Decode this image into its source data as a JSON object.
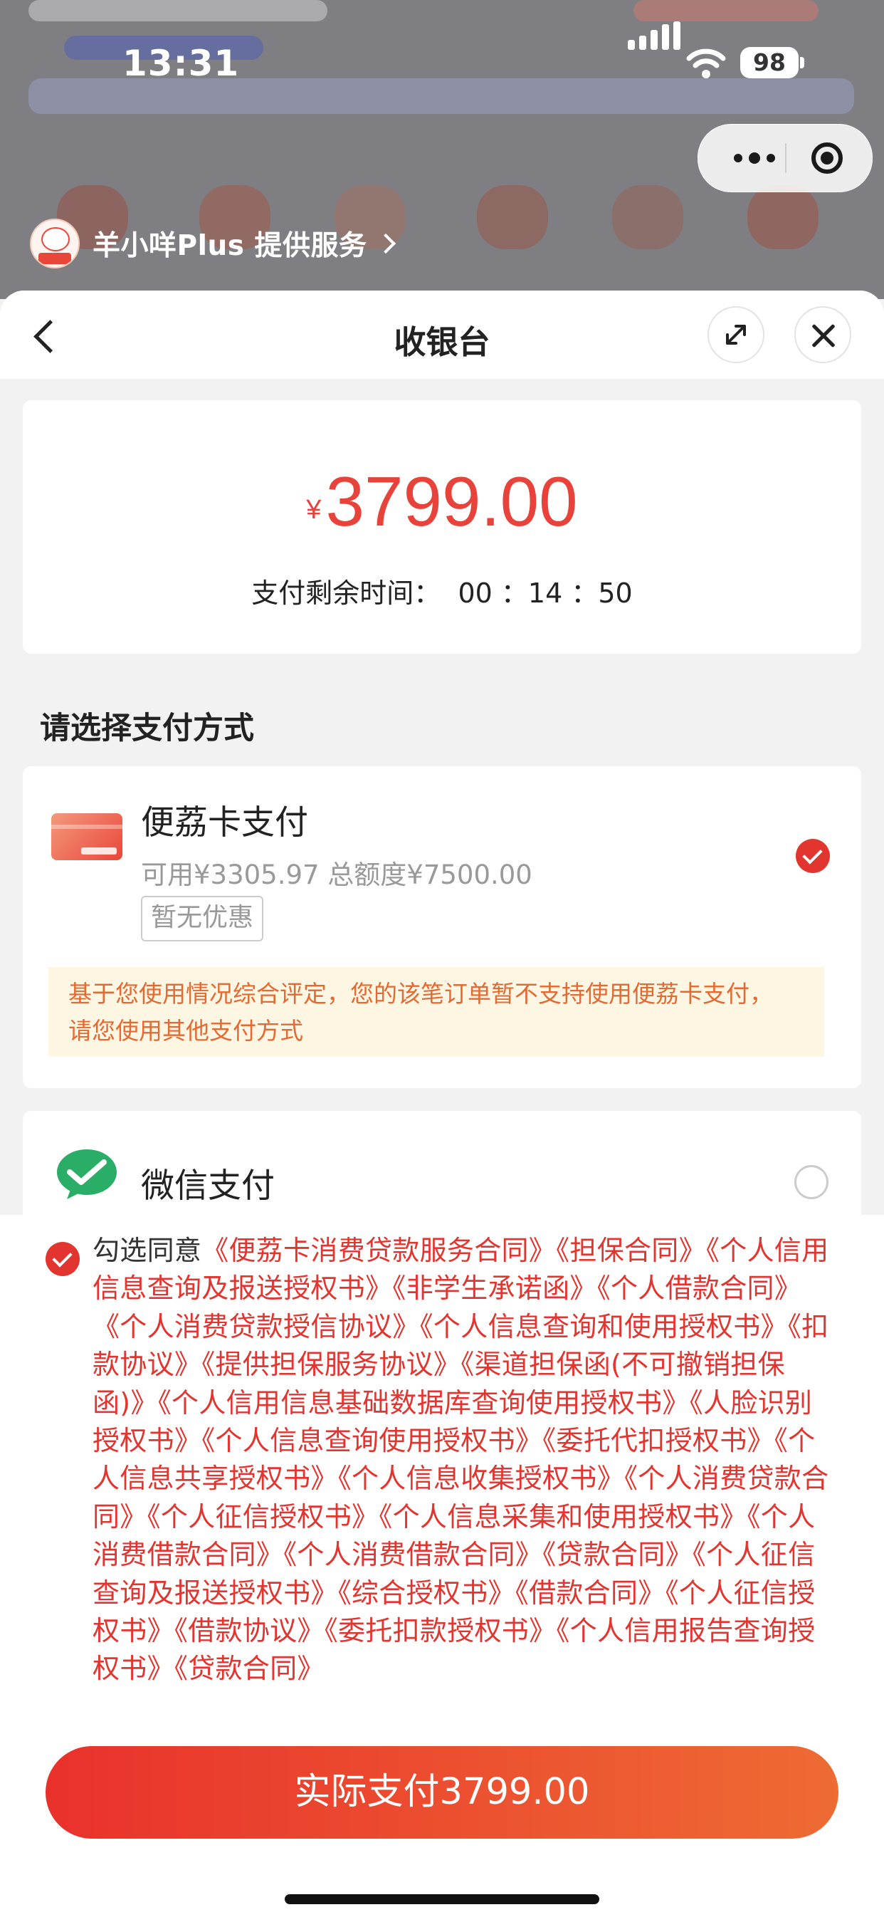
{
  "status_bar": {
    "time": "13:31",
    "battery": "98"
  },
  "mini_program": {
    "provider_text": "羊小咩Plus 提供服务"
  },
  "sheet": {
    "title": "收银台",
    "amount": {
      "currency": "¥",
      "value": "3799.00"
    },
    "countdown": "支付剩余时间：  00 ：14 ：50"
  },
  "section_title": "请选择支付方式",
  "methods": [
    {
      "name": "便荔卡支付",
      "sub": "可用¥3305.97 总额度¥7500.00",
      "tag": "暂无优惠",
      "selected": true,
      "notice_line1": "基于您使用情况综合评定，您的该笔订单暂不支持使用便荔卡支付，",
      "notice_line2": "请您使用其他支付方式"
    },
    {
      "name": "微信支付",
      "selected": false
    }
  ],
  "agreement": {
    "checked": true,
    "lead": "勾选同意",
    "documents": "《便荔卡消费贷款服务合同》《担保合同》《个人信用信息查询及报送授权书》《非学生承诺函》《个人借款合同》《个人消费贷款授信协议》《个人信息查询和使用授权书》《扣款协议》《提供担保服务协议》《渠道担保函(不可撤销担保函)》《个人信用信息基础数据库查询使用授权书》《人脸识别授权书》《个人信息查询使用授权书》《委托代扣授权书》《个人信息共享授权书》《个人信息收集授权书》《个人消费贷款合同》《个人征信授权书》《个人信息采集和使用授权书》《个人消费借款合同》《个人消费借款合同》《贷款合同》《个人征信查询及报送授权书》《综合授权书》《借款合同》《个人征信授权书》《借款协议》《委托扣款授权书》《个人信用报告查询授权书》《贷款合同》"
  },
  "pay_button": "实际支付3799.00",
  "colors": {
    "accent": "#e3352f",
    "wechat": "#2aae67",
    "notice_bg": "#fdf6e2"
  }
}
